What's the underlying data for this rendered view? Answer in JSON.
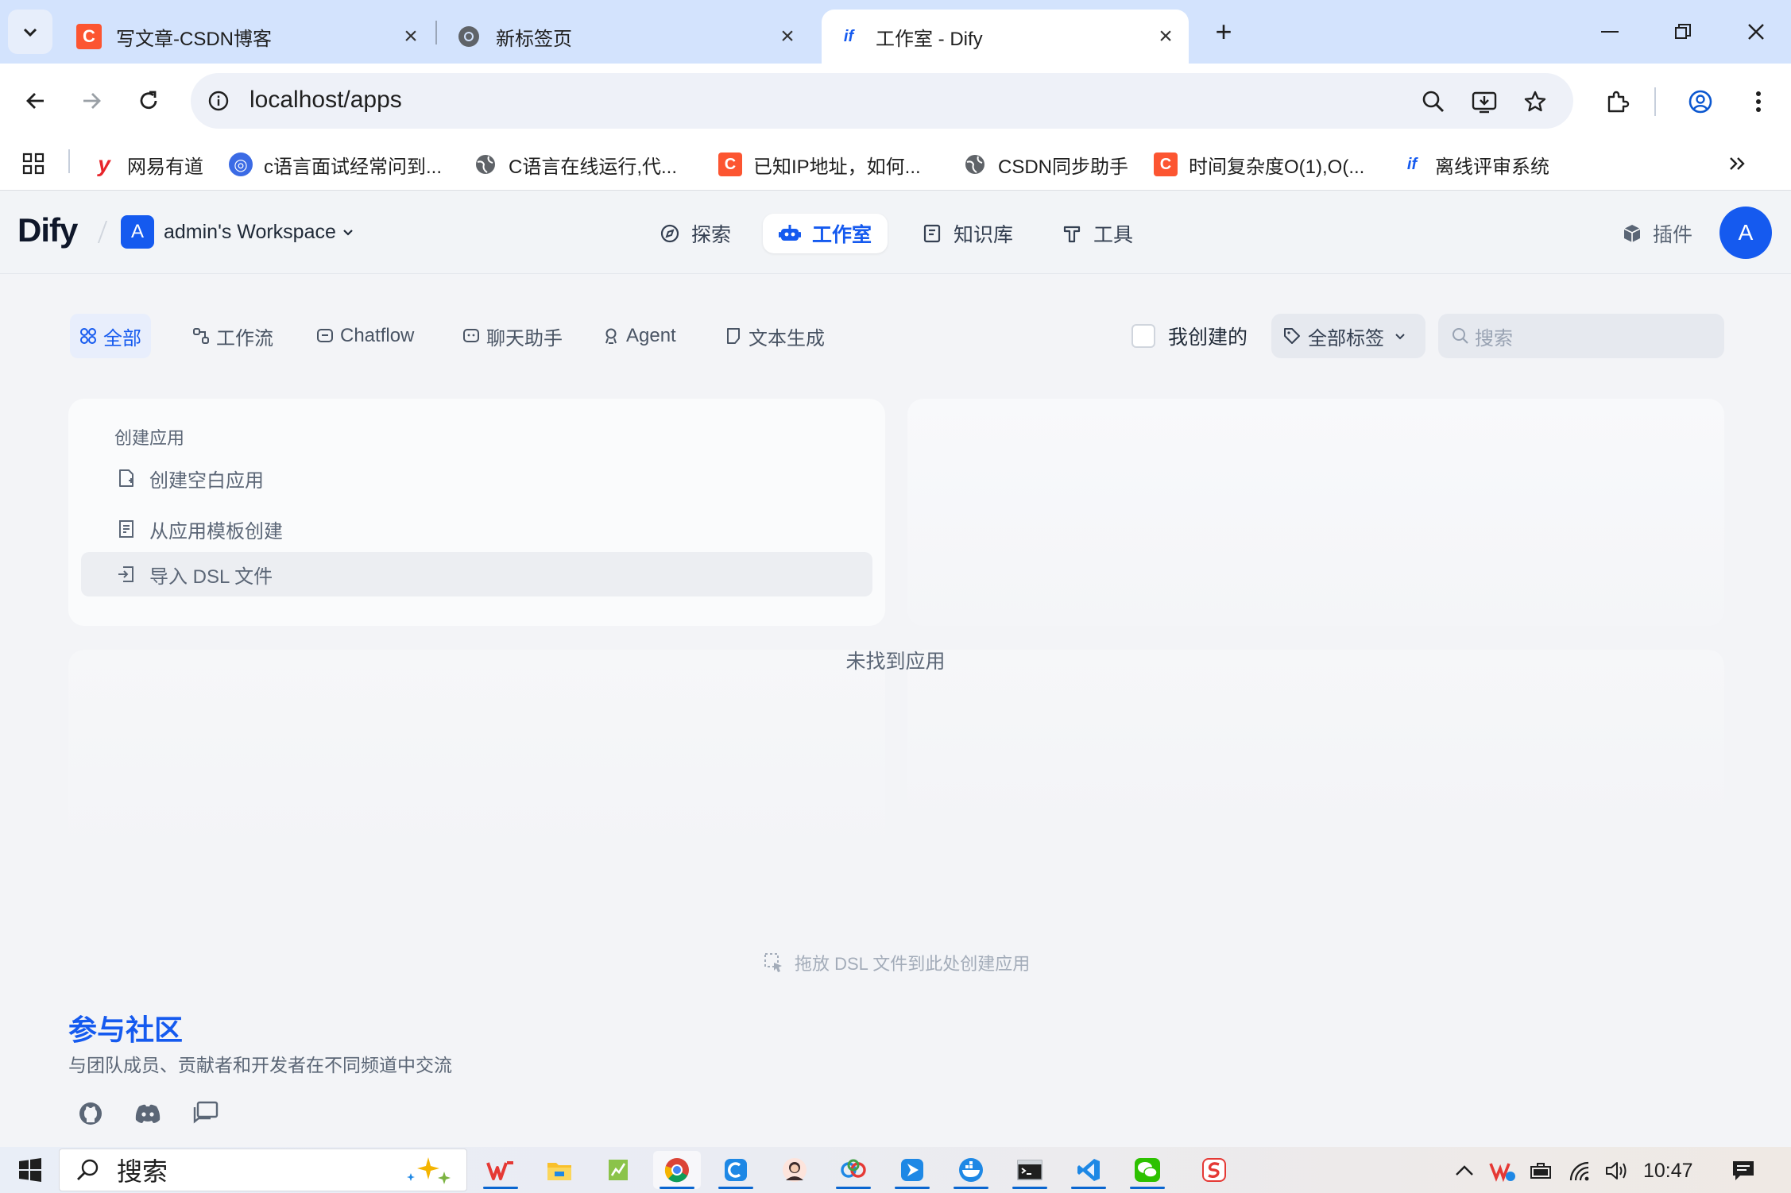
{
  "browser": {
    "tabs": [
      {
        "title": "写文章-CSDN博客",
        "icon": "csdn-icon"
      },
      {
        "title": "新标签页",
        "icon": "chrome-icon"
      },
      {
        "title": "工作室 - Dify",
        "icon": "dify-icon"
      }
    ],
    "url": "localhost/apps",
    "bookmarks": [
      {
        "label": "网易有道",
        "icon": "youdao-icon"
      },
      {
        "label": "c语言面试经常问到...",
        "icon": "bookmark-icon"
      },
      {
        "label": "C语言在线运行,代...",
        "icon": "globe-icon"
      },
      {
        "label": "已知IP地址，如何...",
        "icon": "csdn-icon"
      },
      {
        "label": "CSDN同步助手",
        "icon": "globe-icon"
      },
      {
        "label": "时间复杂度O(1),O(...",
        "icon": "csdn-icon"
      },
      {
        "label": "离线评审系统",
        "icon": "dify-icon"
      }
    ]
  },
  "app": {
    "logo": "Dify",
    "workspace_initial": "A",
    "workspace_name": "admin's Workspace",
    "nav": [
      "探索",
      "工作室",
      "知识库",
      "工具"
    ],
    "nav_active": "工作室",
    "plugins_label": "插件",
    "avatar_initial": "A",
    "filters": [
      "全部",
      "工作流",
      "Chatflow",
      "聊天助手",
      "Agent",
      "文本生成"
    ],
    "filter_active": "全部",
    "created_by_me": "我创建的",
    "tags_label": "全部标签",
    "search_placeholder": "搜索",
    "create_title": "创建应用",
    "create_items": [
      "创建空白应用",
      "从应用模板创建",
      "导入 DSL 文件"
    ],
    "empty_text": "未找到应用",
    "drop_hint": "拖放 DSL 文件到此处创建应用",
    "community_title": "参与社区",
    "community_desc": "与团队成员、贡献者和开发者在不同频道中交流",
    "accent": "#155aef"
  },
  "taskbar": {
    "search_label": "搜索",
    "time": "10:47"
  }
}
